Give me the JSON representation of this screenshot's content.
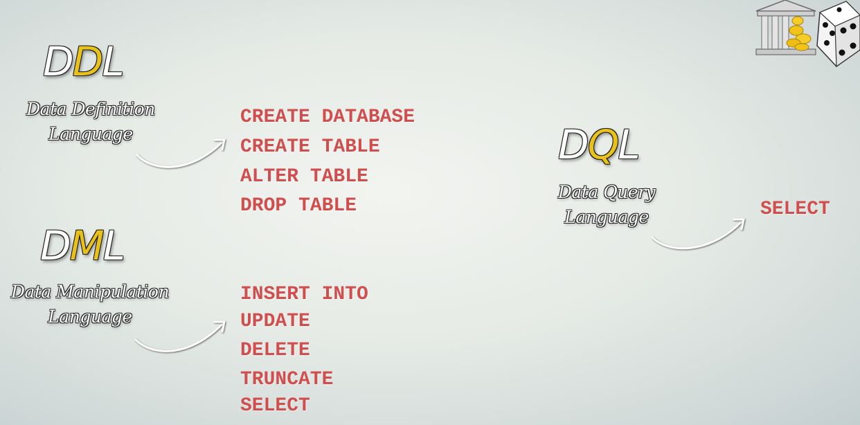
{
  "ddl": {
    "acronym_pre": "D",
    "acronym_hl": "D",
    "acronym_post": "L",
    "line1": "Data Definition",
    "line2": "Language",
    "commands": [
      "CREATE DATABASE",
      "CREATE TABLE",
      "ALTER TABLE",
      "DROP TABLE"
    ]
  },
  "dml": {
    "acronym_pre": "D",
    "acronym_hl": "M",
    "acronym_post": "L",
    "line1": "Data Manipulation",
    "line2": "Language",
    "commands": [
      "INSERT INTO",
      "UPDATE",
      "DELETE",
      "TRUNCATE",
      "SELECT"
    ]
  },
  "dql": {
    "acronym_pre": "D",
    "acronym_hl": "Q",
    "acronym_post": "L",
    "line1": "Data Query",
    "line2": "Language",
    "commands": [
      "SELECT"
    ]
  },
  "colors": {
    "highlight": "#e8c21a",
    "command": "#cf4f4f",
    "label": "#ffffff"
  },
  "logo_icon": "bank-dice-icon"
}
